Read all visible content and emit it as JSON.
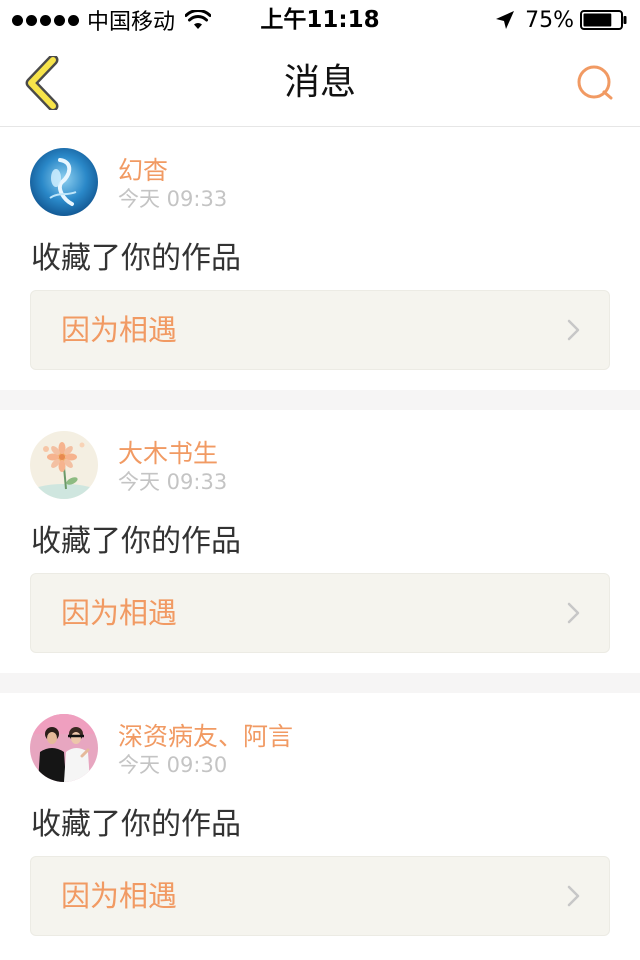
{
  "status_bar": {
    "carrier": "中国移动",
    "time": "上午11:18",
    "battery": "75%",
    "battery_level": 0.75
  },
  "nav": {
    "title": "消息",
    "back_icon": "chevron-left-icon",
    "search_icon": "search-icon"
  },
  "colors": {
    "accent": "#f19a63",
    "back_icon_fill": "#f7e44a",
    "card_bg": "#f5f4ee",
    "separator": "#f6f5f5",
    "time_text": "#c4c4c4"
  },
  "messages": [
    {
      "name": "幻杳",
      "time": "今天 09:33",
      "text": "收藏了你的作品",
      "work_title": "因为相遇"
    },
    {
      "name": "大木书生",
      "time": "今天 09:33",
      "text": "收藏了你的作品",
      "work_title": "因为相遇"
    },
    {
      "name": "深资病友、阿言",
      "time": "今天 09:30",
      "text": "收藏了你的作品",
      "work_title": "因为相遇"
    }
  ]
}
